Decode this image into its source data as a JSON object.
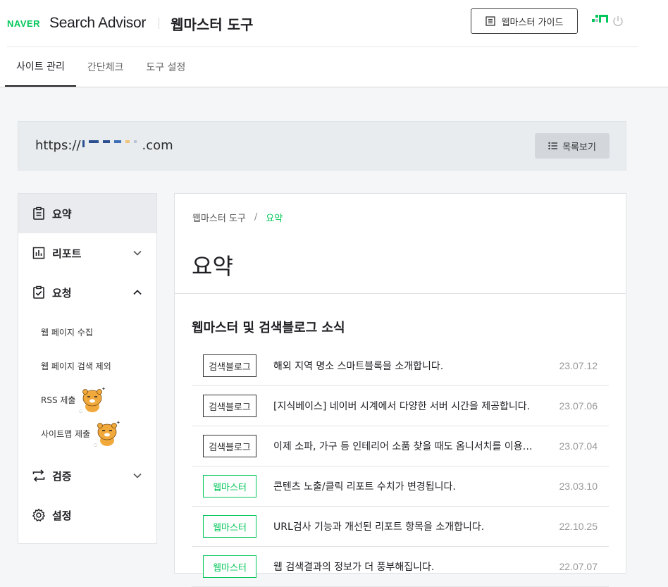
{
  "header": {
    "logo": "NAVER",
    "product": "Search Advisor",
    "tool_title": "웹마스터 도구",
    "guide_button": "웹마스터 가이드",
    "tabs": [
      {
        "label": "사이트 관리",
        "active": true
      },
      {
        "label": "간단체크",
        "active": false
      },
      {
        "label": "도구 설정",
        "active": false
      }
    ]
  },
  "site": {
    "url_prefix": "https://",
    "url_suffix": ".com",
    "list_button": "목록보기"
  },
  "sidebar": {
    "items": [
      {
        "label": "요약",
        "icon": "clipboard-icon",
        "active": true
      },
      {
        "label": "리포트",
        "icon": "bar-chart-icon",
        "expanded": false
      },
      {
        "label": "요청",
        "icon": "clipboard-check-icon",
        "expanded": true
      },
      {
        "label": "검증",
        "icon": "sync-arrows-icon",
        "expanded": false
      },
      {
        "label": "설정",
        "icon": "gear-icon"
      }
    ],
    "sub_items": [
      {
        "label": "웹 페이지 수집"
      },
      {
        "label": "웹 페이지 검색 제외"
      },
      {
        "label": "RSS 제출"
      },
      {
        "label": "사이트맵 제출"
      }
    ]
  },
  "main": {
    "breadcrumb_root": "웹마스터 도구",
    "breadcrumb_separator": "/",
    "breadcrumb_current": "요약",
    "title": "요약",
    "news_section_title": "웹마스터 및 검색블로그 소식",
    "news": [
      {
        "badge": "검색블로그",
        "badge_style": "dark",
        "title": "해외 지역 명소 스마트블록을 소개합니다.",
        "date": "23.07.12"
      },
      {
        "badge": "검색블로그",
        "badge_style": "dark",
        "title": "[지식베이스] 네이버 시계에서 다양한 서버 시간을 제공합니다.",
        "date": "23.07.06"
      },
      {
        "badge": "검색블로그",
        "badge_style": "dark",
        "title": "이제 소파, 가구 등 인테리어 소품 찾을 때도 옴니서치를 이용…",
        "date": "23.07.04"
      },
      {
        "badge": "웹마스터",
        "badge_style": "green",
        "title": "콘텐츠 노출/클릭 리포트 수치가 변경됩니다.",
        "date": "23.03.10"
      },
      {
        "badge": "웹마스터",
        "badge_style": "green",
        "title": "URL검사 기능과 개선된 리포트 항목을 소개합니다.",
        "date": "22.10.25"
      },
      {
        "badge": "웹마스터",
        "badge_style": "green",
        "title": "웹 검색결과의 정보가 더 풍부해집니다.",
        "date": "22.07.07"
      }
    ]
  },
  "colors": {
    "brand_green": "#03c75a",
    "text_dark": "#1e1e23"
  }
}
